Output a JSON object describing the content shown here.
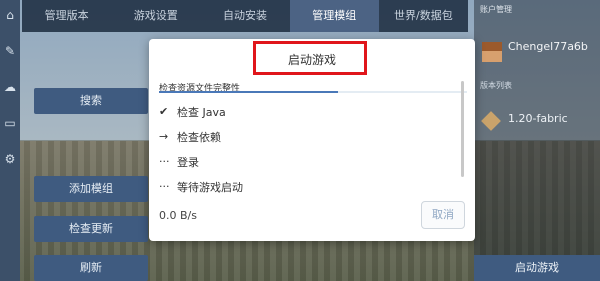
{
  "tabs": [
    "管理版本",
    "游戏设置",
    "自动安装",
    "管理模组",
    "世界/数据包"
  ],
  "left_buttons": {
    "search": "搜索",
    "add_mod": "添加模组",
    "check_update": "检查更新",
    "refresh": "刷新"
  },
  "right_panel": {
    "title": "账户管理",
    "username": "Chengel77a6b",
    "section": "版本列表",
    "version": "1.20-fabric",
    "launch": "启动游戏"
  },
  "modal": {
    "title": "启动游戏",
    "task_label": "检查资源文件完整性",
    "progress": 0.58,
    "steps": [
      {
        "symbol": "✔",
        "label": "检查 Java"
      },
      {
        "symbol": "→",
        "label": "检查依赖"
      },
      {
        "symbol": "···",
        "label": "登录"
      },
      {
        "symbol": "···",
        "label": "等待游戏启动"
      }
    ],
    "speed": "0.0 B/s",
    "cancel": "取消"
  },
  "icons": [
    "home-icon",
    "wrench-icon",
    "download-icon",
    "gamepad-icon",
    "gear-icon"
  ],
  "colors": {
    "highlight": "#e0161b",
    "accent": "#4a78b8",
    "nav": "#3c5069"
  }
}
